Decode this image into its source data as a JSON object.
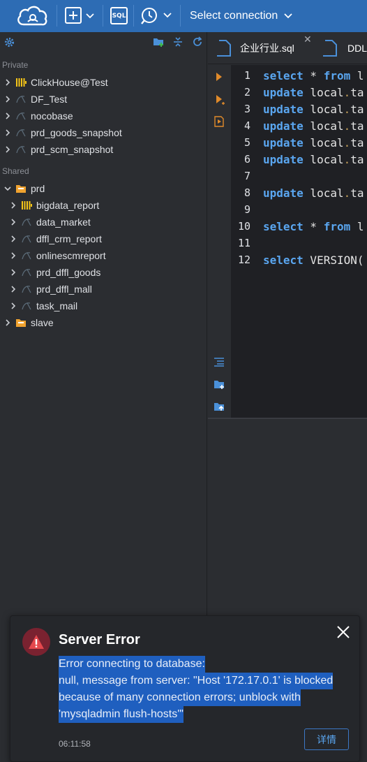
{
  "topbar": {
    "connection_label": "Select connection",
    "sql_label": "SQL"
  },
  "sidebar": {
    "private_label": "Private",
    "private_items": [
      {
        "label": "ClickHouse@Test",
        "icon": "clickhouse-icon"
      },
      {
        "label": "DF_Test",
        "icon": "mysql-icon"
      },
      {
        "label": "nocobase",
        "icon": "mysql-icon"
      },
      {
        "label": "prd_goods_snapshot",
        "icon": "mysql-icon"
      },
      {
        "label": "prd_scm_snapshot",
        "icon": "mysql-icon"
      }
    ],
    "shared_label": "Shared",
    "shared_folder": "prd",
    "shared_items": [
      {
        "label": "bigdata_report",
        "icon": "clickhouse-icon"
      },
      {
        "label": "data_market",
        "icon": "mysql-icon"
      },
      {
        "label": "dffl_crm_report",
        "icon": "mysql-icon"
      },
      {
        "label": "onlinescmreport",
        "icon": "mysql-icon"
      },
      {
        "label": "prd_dffl_goods",
        "icon": "mysql-icon"
      },
      {
        "label": "prd_dffl_mall",
        "icon": "mysql-icon"
      },
      {
        "label": "task_mail",
        "icon": "mysql-icon"
      }
    ],
    "slave_folder": "slave"
  },
  "tabs": [
    {
      "label": "企业行业.sql"
    },
    {
      "label": "DDL"
    }
  ],
  "editor": {
    "line_numbers": [
      "1",
      "2",
      "3",
      "4",
      "5",
      "6",
      "7",
      "8",
      "9",
      "10",
      "11",
      "12"
    ],
    "lines": [
      {
        "kw": "select",
        "rest": " * ",
        "kw2": "from",
        "tail": " l"
      },
      {
        "kw": "update",
        "rest": " local",
        "dot": ".",
        "tail": "ta"
      },
      {
        "kw": "update",
        "rest": " local",
        "dot": ".",
        "tail": "ta"
      },
      {
        "kw": "update",
        "rest": " local",
        "dot": ".",
        "tail": "ta"
      },
      {
        "kw": "update",
        "rest": " local",
        "dot": ".",
        "tail": "ta"
      },
      {
        "kw": "update",
        "rest": " local",
        "dot": ".",
        "tail": "ta"
      },
      {
        "kw": "",
        "rest": "",
        "dot": "",
        "tail": ""
      },
      {
        "kw": "update",
        "rest": " local",
        "dot": ".",
        "tail": "ta"
      },
      {
        "kw": "",
        "rest": "",
        "dot": "",
        "tail": ""
      },
      {
        "kw": "select",
        "rest": " * ",
        "kw2": "from",
        "tail": " l"
      },
      {
        "kw": "",
        "rest": "",
        "dot": "",
        "tail": ""
      },
      {
        "kw": "select",
        "rest": " VERSION(",
        "dot": "",
        "tail": ""
      }
    ]
  },
  "toast": {
    "title": "Server Error",
    "message_lines": [
      "Error connecting to database:",
      "null, message from server: \"Host '172.17.0.1' is blocked",
      "because of many connection errors; unblock with",
      "'mysqladmin flush-hosts'\""
    ],
    "time": "06:11:58",
    "details_button": "详情",
    "close_symbol": "✕"
  },
  "colors": {
    "topbar": "#2d6cb4",
    "keyword": "#5aa6f0",
    "error": "#e5484d",
    "selection": "#1f5fbf"
  }
}
